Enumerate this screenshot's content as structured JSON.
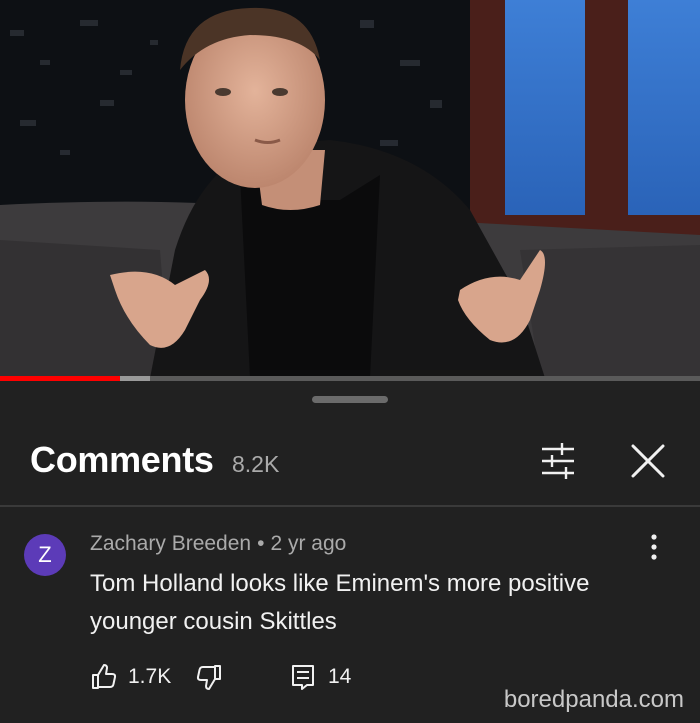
{
  "video": {
    "progress_played": 0.171,
    "progress_buffered": 0.214,
    "progress_color": "#ff0000"
  },
  "comments_panel": {
    "title": "Comments",
    "count": "8.2K",
    "filter_icon": "sliders-icon",
    "close_icon": "close-icon"
  },
  "comment": {
    "avatar_letter": "Z",
    "avatar_color": "#5c3bb8",
    "author": "Zachary Breeden",
    "separator": "•",
    "time": "2 yr ago",
    "text": "Tom Holland looks like Eminem's more positive younger cousin Skittles",
    "likes": "1.7K",
    "replies": "14"
  },
  "watermark": "boredpanda.com"
}
